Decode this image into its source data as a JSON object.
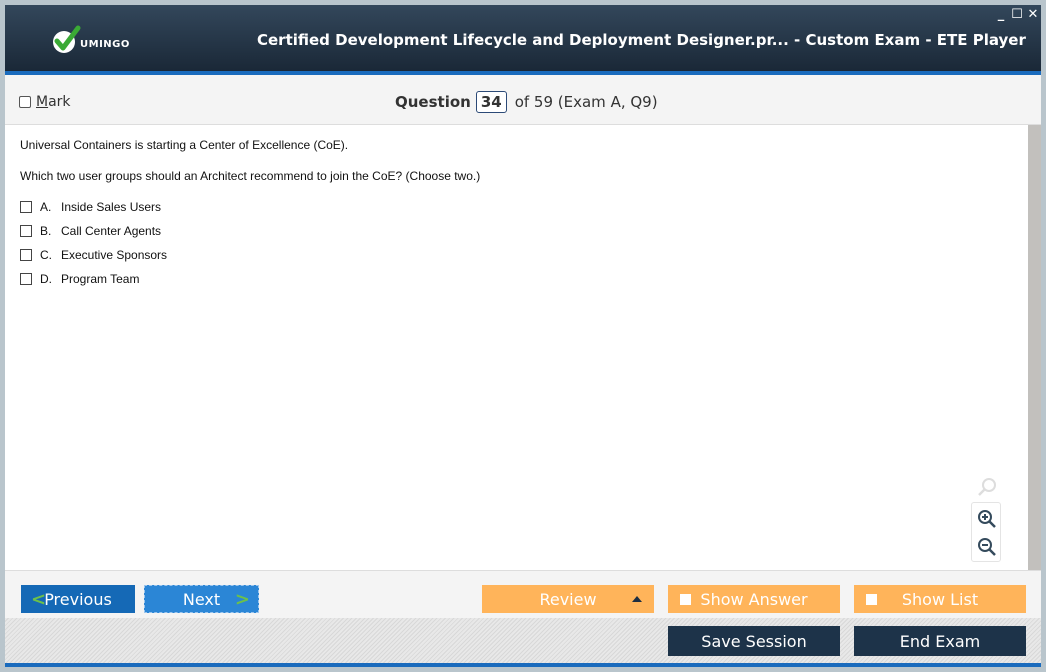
{
  "app": {
    "logo_text": "UMINGO",
    "title": "Certified Development Lifecycle and Deployment Designer.pr... - Custom Exam - ETE Player",
    "window_controls": {
      "minimize": "_",
      "maximize": "☐",
      "close": "✕"
    }
  },
  "question_bar": {
    "mark_label_first": "M",
    "mark_label_rest": "ark",
    "mark_checked": false,
    "question_label": "Question",
    "current": "34",
    "total_text": "of 59 (Exam A, Q9)"
  },
  "question": {
    "lines": [
      "Universal Containers is starting a Center of Excellence (CoE).",
      "Which two user groups should an Architect recommend to join the CoE? (Choose two.)"
    ],
    "options": [
      {
        "letter": "A.",
        "text": "Inside Sales Users",
        "checked": false
      },
      {
        "letter": "B.",
        "text": "Call Center Agents",
        "checked": false
      },
      {
        "letter": "C.",
        "text": "Executive Sponsors",
        "checked": false
      },
      {
        "letter": "D.",
        "text": "Program Team",
        "checked": false
      }
    ]
  },
  "zoom_controls": {
    "icons": [
      "search-icon",
      "zoom-in-icon",
      "zoom-out-icon"
    ]
  },
  "nav": {
    "previous": "Previous",
    "next": "Next",
    "prev_glyph": "<",
    "next_glyph": ">"
  },
  "actions": {
    "review": "Review",
    "show_answer": "Show Answer",
    "show_list": "Show List",
    "save_session": "Save Session",
    "end_exam": "End Exam"
  },
  "colors": {
    "accent_blue": "#1a6bbd",
    "orange": "#ffb45a",
    "dark_navy": "#1d3349",
    "logo_green": "#3aaa35"
  }
}
